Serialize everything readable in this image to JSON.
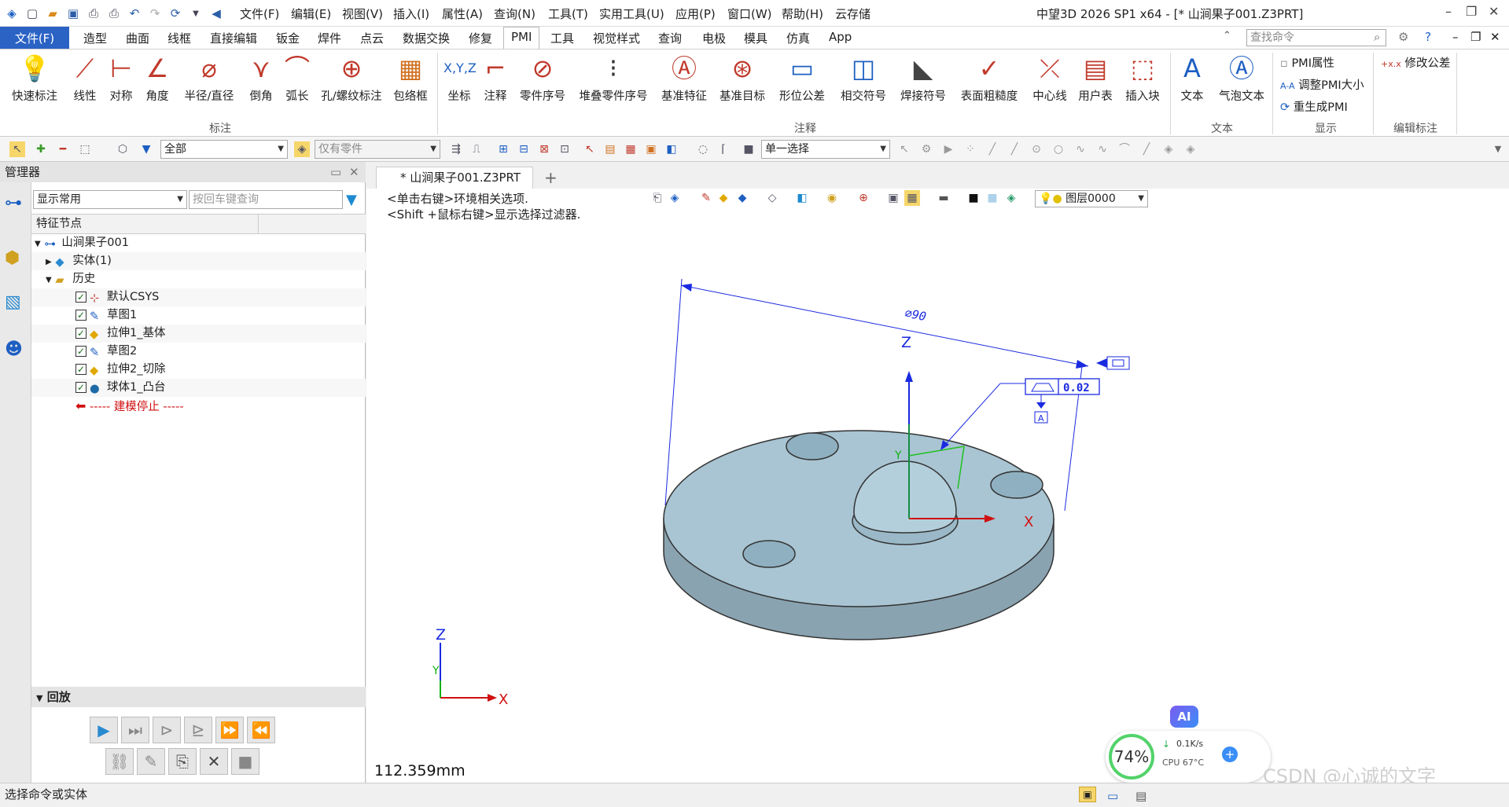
{
  "title_bar": {
    "menu": [
      "文件(F)",
      "编辑(E)",
      "视图(V)",
      "插入(I)",
      "属性(A)",
      "查询(N)",
      "工具(T)",
      "实用工具(U)",
      "应用(P)",
      "窗口(W)",
      "帮助(H)",
      "云存储"
    ],
    "app_title": "中望3D 2026 SP1 x64  - [* 山涧果子001.Z3PRT]"
  },
  "ribbon_tabs": [
    "文件(F)",
    "造型",
    "曲面",
    "线框",
    "直接编辑",
    "钣金",
    "焊件",
    "点云",
    "数据交换",
    "修复",
    "PMI",
    "工具",
    "视觉样式",
    "查询",
    "电极",
    "模具",
    "仿真",
    "App"
  ],
  "active_tab": "PMI",
  "search_placeholder": "查找命令",
  "ribbon": {
    "annot_buttons": [
      "快速标注",
      "线性",
      "对称",
      "角度",
      "半径/直径",
      "倒角",
      "弧长",
      "孔/螺纹标注",
      "包络框"
    ],
    "annot_group": "标注",
    "note_buttons": [
      "坐标",
      "注释",
      "零件序号",
      "堆叠零件序号",
      "基准特征",
      "基准目标",
      "形位公差",
      "相交符号",
      "焊接符号",
      "表面粗糙度",
      "中心线",
      "用户表",
      "插入块"
    ],
    "note_group": "注释",
    "text_buttons": [
      "文本",
      "气泡文本"
    ],
    "text_group": "文本",
    "display_items": [
      "PMI属性",
      "调整PMI大小",
      "重生成PMI"
    ],
    "display_group": "显示",
    "edit_items": [
      "修改公差"
    ],
    "edit_group": "编辑标注"
  },
  "toolbar": {
    "filter_all": "全部",
    "filter_part": "仅有零件",
    "select_mode": "单一选择"
  },
  "manager": {
    "title": "管理器",
    "display_combo": "显示常用",
    "query_placeholder": "按回车键查询",
    "column": "特征节点",
    "root": "山涧果子001",
    "solid": "实体(1)",
    "history": "历史",
    "items": [
      "默认CSYS",
      "草图1",
      "拉伸1_基体",
      "草图2",
      "拉伸2_切除",
      "球体1_凸台"
    ],
    "stop": "----- 建模停止 -----",
    "replay": "回放"
  },
  "doc_tab": "* 山涧果子001.Z3PRT",
  "viewport": {
    "hint1": "<单击右键>环境相关选项.",
    "hint2": "<Shift +鼠标右键>显示选择过滤器.",
    "layer": "图层0000",
    "dim_text": "⌀90",
    "tol_value": "0.02",
    "datum": "A",
    "distance": "112.359mm",
    "axis_x": "X",
    "axis_y": "Y",
    "axis_z": "Z",
    "ai": "AI",
    "cpu_percent": "74%",
    "net_speed": "0.1K/s",
    "cpu_temp": "CPU 67°C"
  },
  "status": "选择命令或实体",
  "watermark": "CSDN @心诚的文字"
}
